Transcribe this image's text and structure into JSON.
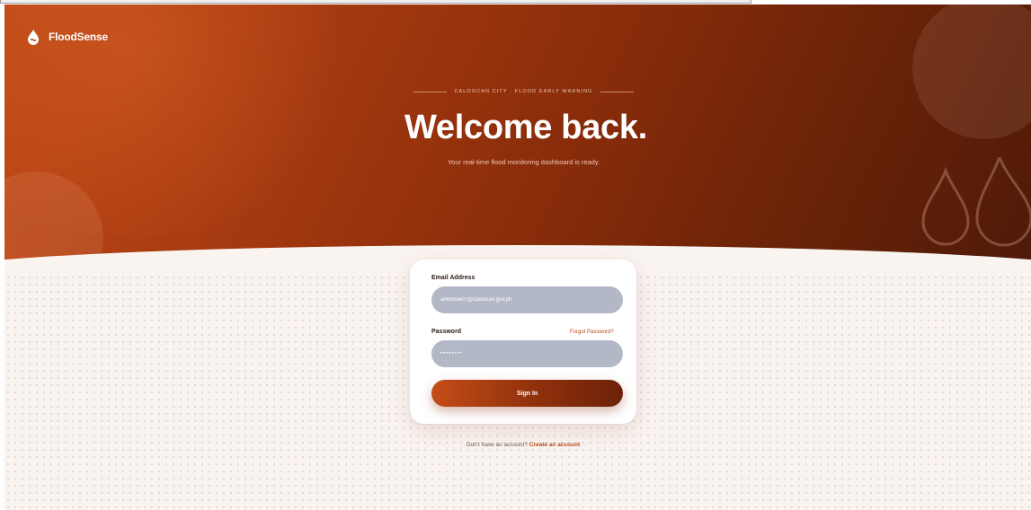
{
  "brand": {
    "name": "FloodSense",
    "icon": "flood-drop-logo"
  },
  "hero": {
    "eyebrow": "CALOOCAN CITY · FLOOD EARLY WARNING",
    "title": "Welcome back.",
    "subtitle": "Your real-time flood monitoring dashboard is ready."
  },
  "login_form": {
    "email_label": "Email Address",
    "email_value": "ambrose07@caloocan.gov.ph",
    "password_label": "Password",
    "password_value": "••••••••",
    "forgot_link": "Forgot Password?",
    "submit_label": "Sign In"
  },
  "signup": {
    "prompt": "Don't have an account?",
    "link": "Create an account"
  },
  "colors": {
    "brand_primary": "#b8471a",
    "brand_dark": "#6d2408",
    "input_fill": "#b3b8c7",
    "background": "#faf4f1"
  }
}
